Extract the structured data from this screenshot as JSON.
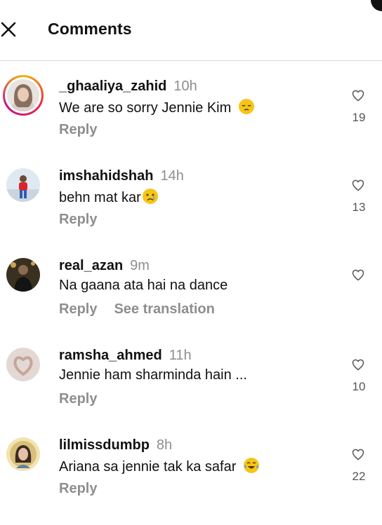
{
  "header": {
    "title": "Comments",
    "close_icon": "close-icon"
  },
  "comments": [
    {
      "username": "_ghaaliya_zahid",
      "time": "10h",
      "text": "We are so sorry Jennie Kim",
      "emoji": "pensive-face",
      "reply": "Reply",
      "likes": "19",
      "story_ring": true
    },
    {
      "username": "imshahidshah",
      "time": "14h",
      "text": "behn mat kar",
      "emoji": "crying-face",
      "reply": "Reply",
      "likes": "13"
    },
    {
      "username": "real_azan",
      "time": "9m",
      "text": "Na gaana ata hai na dance",
      "reply": "Reply",
      "see_translation": "See translation",
      "likes": ""
    },
    {
      "username": "ramsha_ahmed",
      "time": "11h",
      "text": "Jennie ham sharminda hain ...",
      "reply": "Reply",
      "likes": "10"
    },
    {
      "username": "lilmissdumbp",
      "time": "8h",
      "text": "Ariana sa jennie tak ka safar",
      "emoji": "tears-of-joy-face",
      "reply": "Reply",
      "likes": "22"
    }
  ],
  "colors": {
    "muted": "#8e8e8e",
    "text": "#111111",
    "divider": "#d8d8d8",
    "emoji_yellow": "#f5c518"
  }
}
